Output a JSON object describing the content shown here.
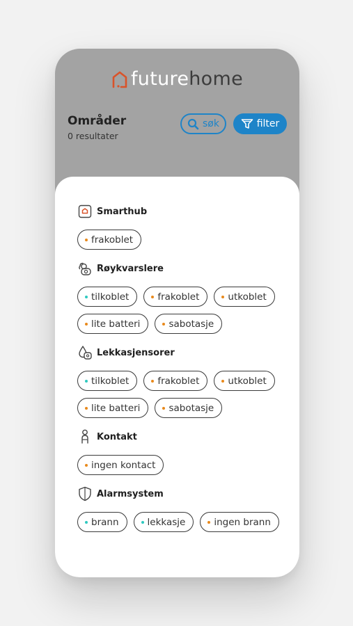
{
  "colors": {
    "accent": "#1e84c8",
    "online": "#2ec9c0",
    "offline": "#e8891c",
    "brand": "#d9532a"
  },
  "brand": {
    "future": "future",
    "home": "home"
  },
  "header": {
    "title": "Områder",
    "subtitle": "0 resultater",
    "search_label": "søk",
    "filter_label": "filter"
  },
  "filters": {
    "sections": [
      {
        "title": "Smarthub",
        "icon": "smarthub-icon",
        "chips": [
          {
            "label": "frakoblet",
            "status": "offline"
          }
        ]
      },
      {
        "title": "Røykvarslere",
        "icon": "smoke-detector-icon",
        "chips": [
          {
            "label": "tilkoblet",
            "status": "online"
          },
          {
            "label": "frakoblet",
            "status": "offline"
          },
          {
            "label": "utkoblet",
            "status": "offline"
          },
          {
            "label": "lite batteri",
            "status": "offline"
          },
          {
            "label": "sabotasje",
            "status": "offline"
          }
        ]
      },
      {
        "title": "Lekkasjensorer",
        "icon": "leak-sensor-icon",
        "chips": [
          {
            "label": "tilkoblet",
            "status": "online"
          },
          {
            "label": "frakoblet",
            "status": "offline"
          },
          {
            "label": "utkoblet",
            "status": "offline"
          },
          {
            "label": "lite batteri",
            "status": "offline"
          },
          {
            "label": "sabotasje",
            "status": "offline"
          }
        ]
      },
      {
        "title": "Kontakt",
        "icon": "person-icon",
        "chips": [
          {
            "label": "ingen kontact",
            "status": "offline"
          }
        ]
      },
      {
        "title": "Alarmsystem",
        "icon": "shield-icon",
        "chips": [
          {
            "label": "brann",
            "status": "online"
          },
          {
            "label": "lekkasje",
            "status": "online"
          },
          {
            "label": "ingen brann",
            "status": "offline"
          }
        ]
      }
    ]
  }
}
